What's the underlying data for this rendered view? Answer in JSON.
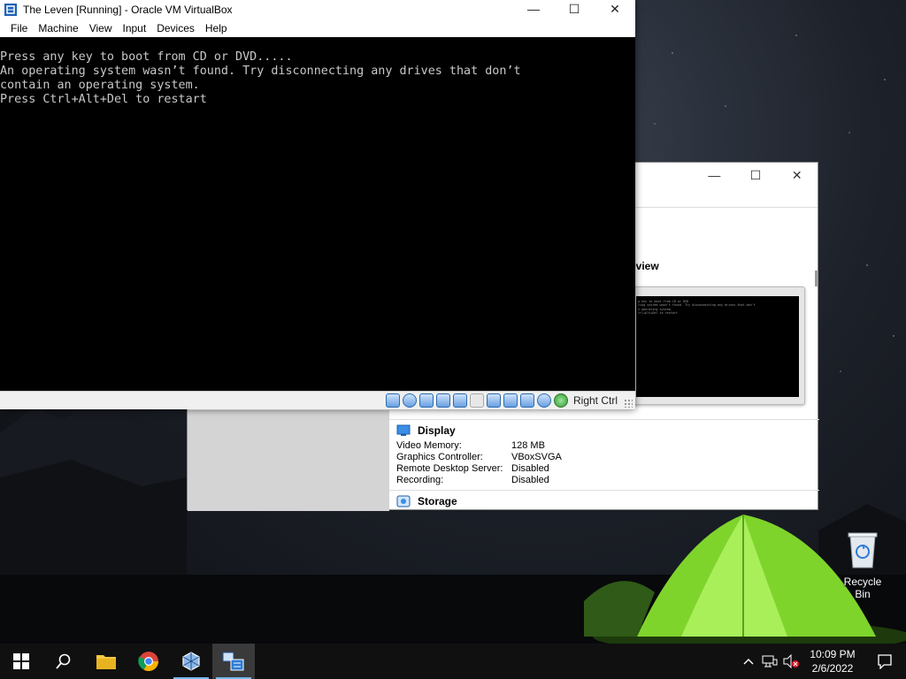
{
  "vm_window": {
    "title": "The Leven [Running] - Oracle VM VirtualBox",
    "menu": [
      "File",
      "Machine",
      "View",
      "Input",
      "Devices",
      "Help"
    ],
    "console_lines": [
      "Press any key to boot from CD or DVD.....",
      "An operating system wasn’t found. Try disconnecting any drives that don’t",
      "contain an operating system.",
      "Press Ctrl+Alt+Del to restart"
    ],
    "status_icons": [
      "hard-disk-icon",
      "optical-drive-icon",
      "audio-icon",
      "network-icon",
      "usb-icon",
      "shared-folders-icon",
      "display-icon",
      "video-capture-icon",
      "virtualization-icon",
      "cpu-icon",
      "mouse-integration-icon"
    ],
    "host_key": "Right Ctrl"
  },
  "manager_window": {
    "preview_heading": "eview",
    "preview_lines": [
      "g key to boot from CD or DVD",
      "ting system wasn't found. Try disconnecting any drives that don't",
      "n operating system.",
      "trl+Alt+Del to restart"
    ],
    "display": {
      "heading": "Display",
      "rows": [
        {
          "label": "Video Memory:",
          "value": "128 MB"
        },
        {
          "label": "Graphics Controller:",
          "value": "VBoxSVGA"
        },
        {
          "label": "Remote Desktop Server:",
          "value": "Disabled"
        },
        {
          "label": "Recording:",
          "value": "Disabled"
        }
      ]
    },
    "storage_heading": "Storage"
  },
  "desktop": {
    "recycle_bin_label": "Recycle Bin"
  },
  "taskbar": {
    "apps": [
      "start-icon",
      "search-icon",
      "file-explorer-icon",
      "chrome-icon",
      "virtualbox-manager-icon",
      "virtualbox-vm-icon"
    ],
    "time": "10:09 PM",
    "date": "2/6/2022"
  },
  "colors": {
    "accent": "#76b9ed",
    "console_text": "#c8c8c8",
    "tent_green": "#8ee038"
  }
}
